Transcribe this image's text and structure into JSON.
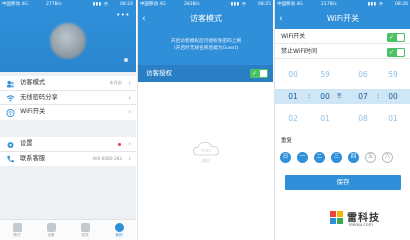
{
  "colors": {
    "accent": "#2f8fd9",
    "switch_on": "#4cc267",
    "alert_dot": "#e23c4a",
    "weekday_on": "#2f8fd9"
  },
  "status_bars": [
    {
      "carrier": "中国移动 4G",
      "speed": "277B/s",
      "time": "08:24"
    },
    {
      "carrier": "中国移动 4G",
      "speed": "283B/s",
      "time": "08:25"
    },
    {
      "carrier": "中国移动 4G",
      "speed": "217B/s",
      "time": "08:26"
    }
  ],
  "profile": {
    "more_icon": "more-dots-icon",
    "menu_top": [
      {
        "label": "访客模式",
        "value": "未开启",
        "icon": "guest-icon"
      },
      {
        "label": "无线密码分享",
        "value": "",
        "icon": "wifi-share-icon"
      },
      {
        "label": "WiFi开关",
        "value": "",
        "icon": "wifi-icon"
      }
    ],
    "menu_bottom": [
      {
        "label": "设置",
        "value": "",
        "icon": "gear-icon",
        "has_dot": true
      },
      {
        "label": "联系客服",
        "value": "400-8080-282",
        "icon": "phone-icon"
      }
    ],
    "tabs": [
      {
        "label": "概况",
        "icon": "overview-icon"
      },
      {
        "label": "设备",
        "icon": "device-icon"
      },
      {
        "label": "发现",
        "icon": "discover-icon"
      },
      {
        "label": "我的",
        "icon": "me-icon",
        "active": true
      }
    ]
  },
  "guest_mode": {
    "title": "访客模式",
    "description_1": "开启访客模权后可授权免密码上网",
    "description_2": "(开启时无线名称后缀为Guest)",
    "auth_label": "访客授权",
    "auth_enabled": true,
    "watermark_text": "路由"
  },
  "wifi_switch": {
    "title": "WiFi开关",
    "switch_label": "WiFi开关",
    "switch_on": true,
    "schedule_label": "禁止WiFi时间",
    "schedule_on": true,
    "picker": {
      "above": [
        "00",
        "59",
        "06",
        "59"
      ],
      "selected": [
        "01",
        "00",
        "07",
        "00"
      ],
      "below": [
        "02",
        "01",
        "08",
        "01"
      ],
      "to_label": "至"
    },
    "repeat_label": "重复",
    "days": [
      {
        "label": "日",
        "on": true
      },
      {
        "label": "一",
        "on": true
      },
      {
        "label": "二",
        "on": true
      },
      {
        "label": "三",
        "on": true
      },
      {
        "label": "四",
        "on": true
      },
      {
        "label": "五",
        "on": false
      },
      {
        "label": "六",
        "on": false
      }
    ],
    "save_label": "保存"
  },
  "brand": {
    "name": "雷科技",
    "url": "leikeji.com"
  }
}
